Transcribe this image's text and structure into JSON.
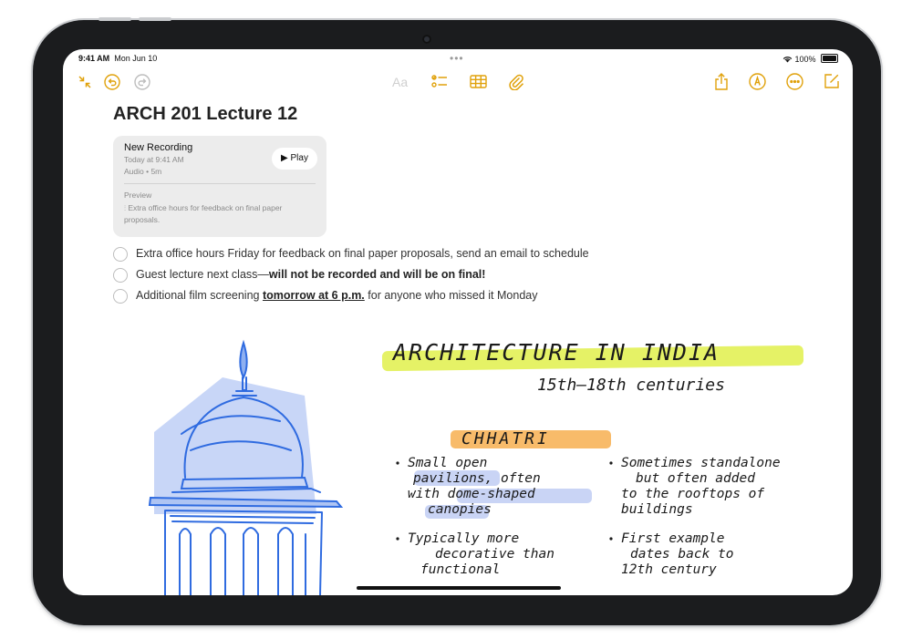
{
  "status": {
    "time": "9:41 AM",
    "date": "Mon Jun 10",
    "battery": "100%"
  },
  "toolbar": {
    "format_label": "Aa"
  },
  "note": {
    "title": "ARCH 201 Lecture 12",
    "recording": {
      "name": "New Recording",
      "time": "Today at 9:41 AM",
      "meta": "Audio • 5m",
      "play_label": "▶ Play",
      "preview_label": "Preview",
      "preview_text": "Extra office hours for feedback on final paper proposals."
    },
    "checklist": [
      {
        "pre": "Extra office hours Friday for feedback on final paper proposals, send an email to schedule",
        "em": "",
        "post": ""
      },
      {
        "pre": "Guest lecture next class—",
        "em": "will not be recorded and will be on final!",
        "post": ""
      },
      {
        "pre": "Additional film screening ",
        "em": "tomorrow at 6 p.m.",
        "post": " for anyone who missed it Monday"
      }
    ]
  },
  "handwriting": {
    "heading": "ARCHITECTURE IN INDIA",
    "subheading": "15th—18th centuries",
    "section": "CHHATRI",
    "bullets": [
      [
        "Small open",
        "pavilions, often",
        "with dome-shaped",
        "canopies"
      ],
      [
        "Sometimes standalone",
        "but often added",
        "to the rooftops of",
        "buildings"
      ],
      [
        "Typically more",
        "decorative than",
        "functional"
      ],
      [
        "First example",
        "dates back to",
        "12th century"
      ]
    ]
  },
  "colors": {
    "accent": "#e0a10a",
    "sketch_blue": "#2f6be0",
    "highlight_yellow": "#e5f266",
    "highlight_orange": "#f7b45a"
  }
}
